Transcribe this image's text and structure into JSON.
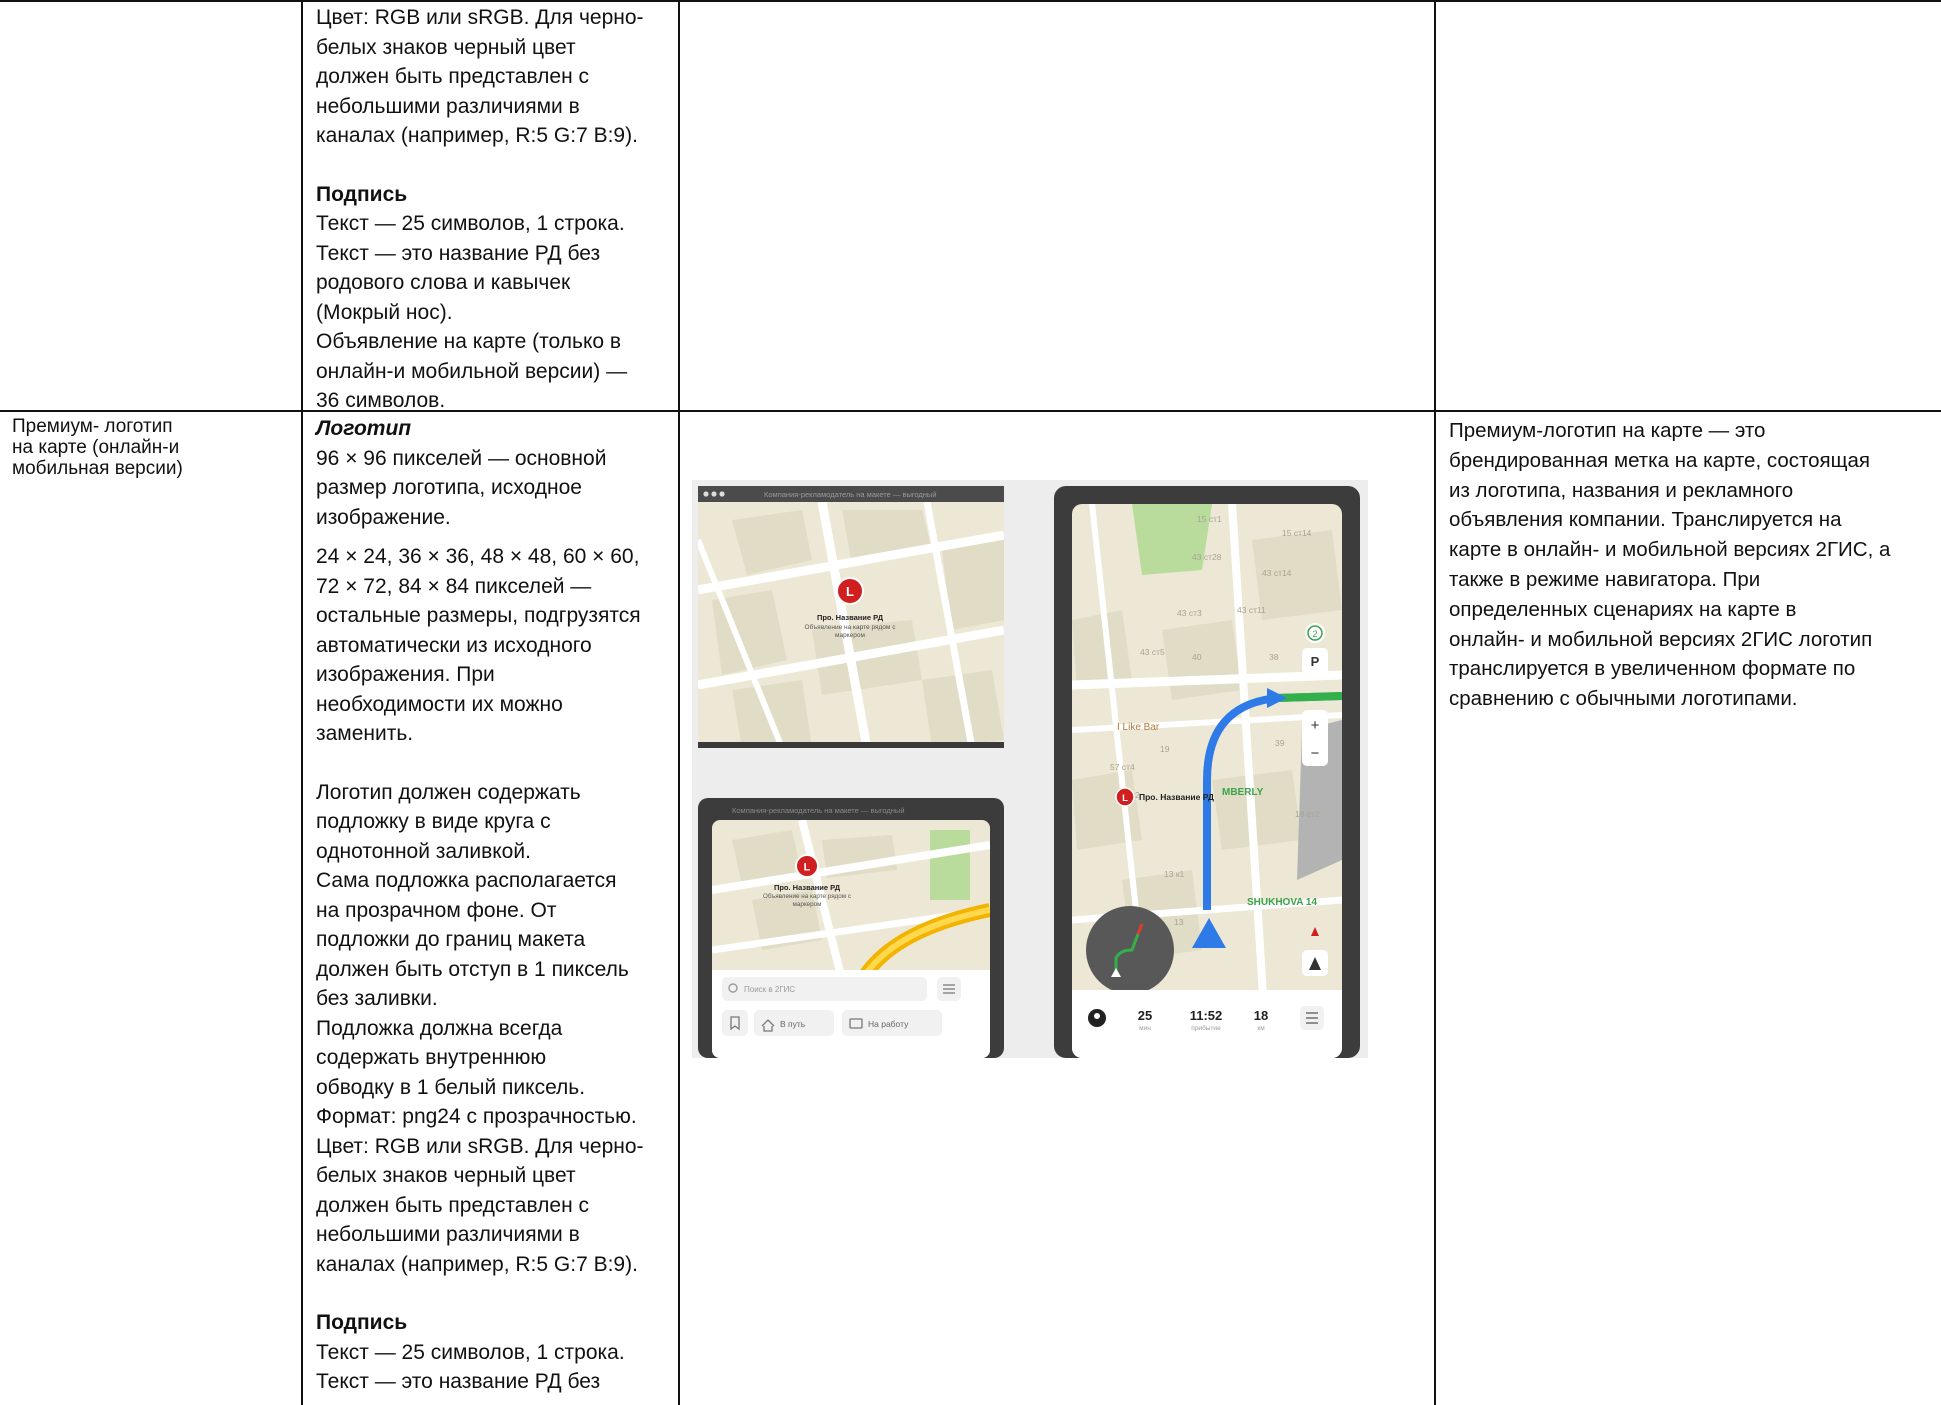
{
  "top_row": {
    "lines": [
      "Цвет: RGB или sRGB. Для черно-",
      "белых знаков черный цвет",
      "должен быть представлен с",
      "небольшими различиями в",
      "каналах (например, R:5 G:7 B:9)."
    ],
    "signature_heading": "Подпись",
    "signature_lines": [
      "Текст — 25 символов, 1 строка.",
      "Текст — это название РД без",
      "родового слова и кавычек",
      "(Мокрый нос).",
      "Объявление на карте (только в",
      "онлайн-и мобильной версии) —",
      "36 символов."
    ]
  },
  "row": {
    "col1_lines": [
      "Премиум- логотип",
      "на карте (онлайн-и",
      "мобильная версии)"
    ],
    "logo_heading": "Логотип",
    "logo_lines_a": [
      "96 × 96 пикселей — основной",
      "размер логотипа, исходное",
      "изображение."
    ],
    "logo_lines_b": [
      "24 × 24, 36 × 36, 48 × 48, 60 × 60,",
      "72 × 72, 84 × 84 пикселей —",
      "остальные размеры, подгрузятся",
      "автоматически из исходного",
      "изображения. При",
      "необходимости их можно",
      "заменить."
    ],
    "logo_lines_c": [
      "Логотип должен содержать",
      "подложку в виде круга с",
      "однотонной заливкой.",
      "Сама подложка располагается",
      "на прозрачном фоне. От",
      "подложки до границ макета",
      "должен быть отступ в 1 пиксель",
      "без заливки.",
      "Подложка должна всегда",
      "содержать внутреннюю",
      "обводку в 1 белый пиксель.",
      "Формат: png24 с прозрачностью.",
      "Цвет: RGB или sRGB. Для черно-",
      "белых знаков черный цвет",
      "должен быть представлен с",
      "небольшими различиями в",
      "каналах (например, R:5 G:7 B:9)."
    ],
    "signature_heading": "Подпись",
    "signature_lines": [
      "Текст — 25 символов, 1 строка.",
      "Текст — это название РД без"
    ],
    "col4_lines": [
      "Премиум-логотип на карте — это",
      "брендированная метка на карте, состоящая",
      "из логотипа, названия и рекламного",
      "объявления компании. Транслируется на",
      "карте в онлайн- и мобильной версиях 2ГИС, а",
      "также в режиме навигатора. При",
      "определенных сценариях на карте в",
      "онлайн- и мобильной версиях 2ГИС логотип",
      "транслируется в увеличенном формате по",
      "сравнению с обычными логотипами."
    ]
  },
  "mockup": {
    "browser_title": "Компания-рекламодатель на макете — выгодный",
    "marker_letter": "L",
    "marker_name": "Про. Название РД",
    "marker_ad_1": "Объявление на карте рядом с",
    "marker_ad_2": "маркером",
    "search_placeholder": "Поиск в 2ГИС",
    "btn_route": "В путь",
    "btn_work": "На работу",
    "nav_labels": {
      "b1": "15 ст1",
      "b2": "15 ст14",
      "b3": "43 ст28",
      "b4": "43 ст14",
      "b5": "43 ст3",
      "b6": "43 ст11",
      "b7": "43 ст5",
      "b8": "40",
      "b9": "38",
      "b10": "39",
      "b11": "19",
      "b12": "57 ст4",
      "b13": "15 ст2",
      "b14": "18 ст2",
      "b15": "13 к1",
      "b16": "13",
      "poi1": "I Like Bar",
      "poi2": "MBERLY",
      "poi3": "SHUKHOVA 14",
      "badge": "2",
      "parking": "P",
      "plus": "+",
      "minus": "−"
    },
    "nav_bar": {
      "min_val": "25",
      "min_unit": "мин",
      "time_val": "11:52",
      "time_unit": "прибытие",
      "km_val": "18",
      "km_unit": "км"
    }
  }
}
